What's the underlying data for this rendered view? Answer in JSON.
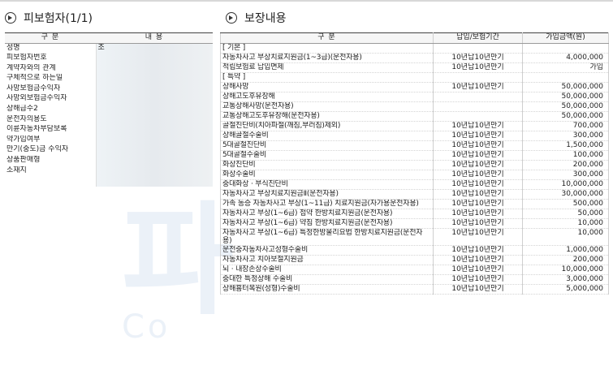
{
  "insured_section": {
    "title": "피보험자(1/1)",
    "col_category": "구 분",
    "col_content": "내 용",
    "rows": [
      {
        "label": "성명",
        "value": "조"
      },
      {
        "label": "피보험자번호",
        "value": ""
      },
      {
        "label": "계약자와의 관계",
        "value": ""
      },
      {
        "label": "구체적으로 하는일",
        "value": ""
      },
      {
        "label": "사망보험금수익자",
        "value": ""
      },
      {
        "label": "사망외보험금수익자",
        "value": ""
      },
      {
        "label": "상해급수2",
        "value": ""
      },
      {
        "label": "운전자의용도",
        "value": ""
      },
      {
        "label": "이륜자동차부담보록",
        "value": ""
      },
      {
        "label": "약가입여부",
        "value": ""
      },
      {
        "label": "만기(중도)금 수익자",
        "value": ""
      },
      {
        "label": "상품판매형",
        "value": ""
      },
      {
        "label": "소재지",
        "value": ""
      }
    ]
  },
  "coverage_section": {
    "title": "보장내용",
    "col_category": "구 분",
    "col_period": "납입/보험기간",
    "col_amount": "가입금액(원)",
    "rows": [
      {
        "name": "[ 기본 ]",
        "period": "",
        "amount": ""
      },
      {
        "name": "자동차사고 부상치료지원금(1~3급)(운전자용)",
        "period": "10년납10년만기",
        "amount": "4,000,000"
      },
      {
        "name": "적립보험료 납입면제",
        "period": "10년납10년만기",
        "amount": "가입"
      },
      {
        "name": "[ 특약 ]",
        "period": "",
        "amount": ""
      },
      {
        "name": "상해사망",
        "period": "10년납10년만기",
        "amount": "50,000,000"
      },
      {
        "name": "상해고도후유장해",
        "period": "",
        "amount": "50,000,000"
      },
      {
        "name": "교통상해사망(운전자용)",
        "period": "",
        "amount": "50,000,000"
      },
      {
        "name": "교통상해고도후유장해(운전자용)",
        "period": "",
        "amount": "50,000,000"
      },
      {
        "name": "골절진단비(치아파절(깨짐,부러짐)제외)",
        "period": "10년납10년만기",
        "amount": "700,000"
      },
      {
        "name": "상해골절수술비",
        "period": "10년납10년만기",
        "amount": "300,000"
      },
      {
        "name": "5대골절진단비",
        "period": "10년납10년만기",
        "amount": "1,500,000"
      },
      {
        "name": "5대골절수술비",
        "period": "10년납10년만기",
        "amount": "100,000"
      },
      {
        "name": "화상진단비",
        "period": "10년납10년만기",
        "amount": "200,000"
      },
      {
        "name": "화상수술비",
        "period": "10년납10년만기",
        "amount": "300,000"
      },
      {
        "name": "중대화상 · 부식진단비",
        "period": "10년납10년만기",
        "amount": "10,000,000"
      },
      {
        "name": "자동차사고 부상치료지원금Ⅱ(운전자용)",
        "period": "10년납10년만기",
        "amount": "30,000,000"
      },
      {
        "name": "가족 동승 자동차사고 부상(1~11급) 치료지원금(자가용운전자용)",
        "period": "10년납10년만기",
        "amount": "500,000",
        "tall": true
      },
      {
        "name": "자동차사고 부상(1~6급) 첩약 한방치료지원금(운전자용)",
        "period": "10년납10년만기",
        "amount": "50,000",
        "tall": true
      },
      {
        "name": "자동차사고 부상(1~6급) 약침 한방치료지원금(운전자용)",
        "period": "10년납10년만기",
        "amount": "10,000",
        "tall": true
      },
      {
        "name": "자동차사고 부상(1~6급) 특정한방물리요법 한방치료지원금(운전자용)",
        "period": "10년납10년만기",
        "amount": "10,000",
        "tall": true
      },
      {
        "name": "운전중자동차사고성형수술비",
        "period": "10년납10년만기",
        "amount": "1,000,000"
      },
      {
        "name": "자동차사고 치아보철지원금",
        "period": "10년납10년만기",
        "amount": "200,000"
      },
      {
        "name": "뇌 · 내장손상수술비",
        "period": "10년납10년만기",
        "amount": "10,000,000"
      },
      {
        "name": "중대한 특정상해 수술비",
        "period": "10년납10년만기",
        "amount": "3,000,000"
      },
      {
        "name": "상해흉터복원(성형)수술비",
        "period": "10년납10년만기",
        "amount": "5,000,000"
      }
    ]
  },
  "watermark": {
    "big_text": "파",
    "small_text": "Co"
  }
}
